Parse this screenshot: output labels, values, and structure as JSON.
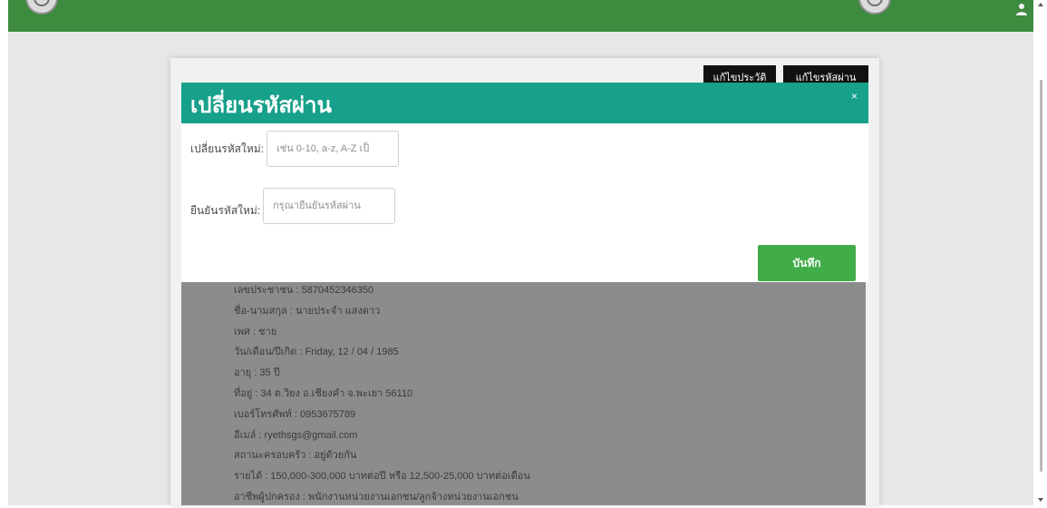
{
  "header": {
    "logo_left_icon": "seal-icon",
    "logo_right_icon": "seal-icon",
    "account_icon": "user-icon"
  },
  "card": {
    "edit_profile_label": "แก้ไขประวัติ",
    "change_password_label": "แก้ไขรหัสผ่าน"
  },
  "profile": {
    "lines": [
      "เลขประชาชน : 5870452346350",
      "ชื่อ-นามสกุล : นายประจำ แสงดาว",
      "เพศ : ชาย",
      "วัน/เดือน/ปีเกิด : Friday, 12 / 04 / 1985",
      "อายุ : 35 ปี",
      "ที่อยู่ : 34 ต.วิยง อ.เชียงคำ จ.พะเยา 56110",
      "เบอร์โทรศัพท์ : 0953675789",
      "อีเมล์ : ryethsgs@gmail.com",
      "สถานะครอบครัว : อยู่ด้วยกัน",
      "รายได้ : 150,000-300,000 บาทต่อปี หรือ 12,500-25,000 บาทต่อเดือน",
      "อาชีพผู้ปกครอง : พนักงานหน่วยงานเอกชน/ลูกจ้างหน่วยงานเอกชน"
    ]
  },
  "modal": {
    "title": "เปลี่ยนรหัสผ่าน",
    "close_label": "×",
    "fields": [
      {
        "label": "เปลี่ยนรหัสใหม่:",
        "placeholder": "เช่น 0-10, a-z, A-Z เป็"
      },
      {
        "label": "ยืนยันรหัสใหม่:",
        "placeholder": "กรุณายืนยันรหัสผ่าน"
      }
    ],
    "save_label": "บันทึก"
  },
  "scrollbar": {
    "up_icon": "scroll-up-icon",
    "down_icon": "scroll-down-icon"
  },
  "colors": {
    "header_green": "#3d8b3e",
    "modal_header_teal": "#17a08a",
    "save_button_green": "#41ad49",
    "card_button_black": "#111111"
  }
}
